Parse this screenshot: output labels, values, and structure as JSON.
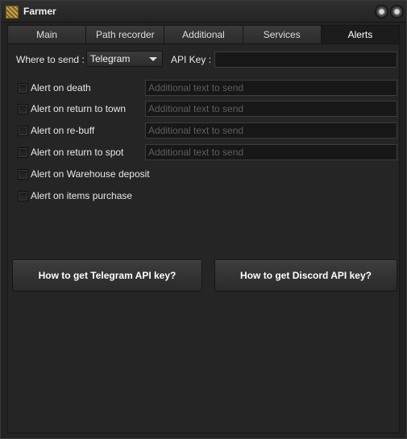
{
  "window": {
    "title": "Farmer"
  },
  "tabs": [
    {
      "label": "Main"
    },
    {
      "label": "Path recorder"
    },
    {
      "label": "Additional"
    },
    {
      "label": "Services"
    },
    {
      "label": "Alerts",
      "active": true
    }
  ],
  "alerts": {
    "where_label": "Where to send :",
    "where_value": "Telegram",
    "api_key_label": "API Key :",
    "api_key_value": "",
    "checks": [
      {
        "label": "Alert on death",
        "checked": false,
        "placeholder": "Additional text to send"
      },
      {
        "label": "Alert on return to town",
        "checked": false,
        "placeholder": "Additional text to send"
      },
      {
        "label": "Alert on re-buff",
        "checked": false,
        "placeholder": "Additional text to send"
      },
      {
        "label": "Alert on return to spot",
        "checked": false,
        "placeholder": "Additional text to send"
      },
      {
        "label": "Alert on Warehouse deposit",
        "checked": false
      },
      {
        "label": "Alert on items purchase",
        "checked": false
      }
    ],
    "telegram_button": "How to get Telegram API key?",
    "discord_button": "How to get Discord API key?"
  }
}
